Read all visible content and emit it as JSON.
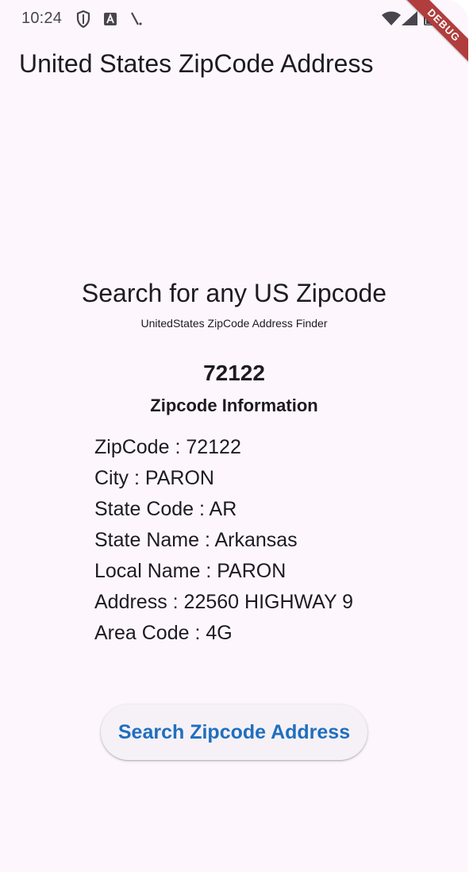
{
  "status_bar": {
    "time": "10:24",
    "icons": [
      "shield-icon",
      "font-a-icon",
      "signal-slash-icon",
      "wifi-icon",
      "cell-signal-icon",
      "battery-icon"
    ]
  },
  "debug_banner": "DEBUG",
  "app_bar": {
    "title": "United States ZipCode Address"
  },
  "main": {
    "headline": "Search for any US Zipcode",
    "subheadline": "UnitedStates ZipCode Address Finder",
    "zipcode": "72122",
    "info_heading": "Zipcode Information",
    "info_lines": [
      "ZipCode : 72122",
      "City : PARON",
      "State Code : AR",
      "State Name : Arkansas",
      "Local Name : PARON",
      "Address : 22560 HIGHWAY 9",
      "Area Code : 4G"
    ],
    "search_button_label": "Search Zipcode Address"
  },
  "colors": {
    "background": "#fdf7fd",
    "text": "#1d1b20",
    "button_text": "#1f6fbf",
    "button_bg": "#f6f1f6",
    "debug_ribbon": "#b13d3d"
  }
}
